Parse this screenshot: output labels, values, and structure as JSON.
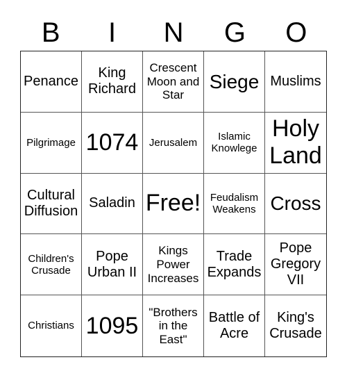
{
  "header": {
    "letters": [
      "B",
      "I",
      "N",
      "G",
      "O"
    ]
  },
  "cells": [
    [
      {
        "text": "Penance",
        "size": "s-md"
      },
      {
        "text": "King Richard",
        "size": "s-md"
      },
      {
        "text": "Crescent Moon and Star",
        "size": "s-sm"
      },
      {
        "text": "Siege",
        "size": "s-lg"
      },
      {
        "text": "Muslims",
        "size": "s-md"
      }
    ],
    [
      {
        "text": "Pilgrimage",
        "size": "s-xs"
      },
      {
        "text": "1074",
        "size": "s-xl"
      },
      {
        "text": "Jerusalem",
        "size": "s-xs"
      },
      {
        "text": "Islamic Knowlege",
        "size": "s-xs"
      },
      {
        "text": "Holy Land",
        "size": "s-xl"
      }
    ],
    [
      {
        "text": "Cultural Diffusion",
        "size": "s-md"
      },
      {
        "text": "Saladin",
        "size": "s-md"
      },
      {
        "text": "Free!",
        "size": "s-xl"
      },
      {
        "text": "Feudalism Weakens",
        "size": "s-xs"
      },
      {
        "text": "Cross",
        "size": "s-lg"
      }
    ],
    [
      {
        "text": "Children's Crusade",
        "size": "s-xs"
      },
      {
        "text": "Pope Urban II",
        "size": "s-md"
      },
      {
        "text": "Kings Power Increases",
        "size": "s-sm"
      },
      {
        "text": "Trade Expands",
        "size": "s-md"
      },
      {
        "text": "Pope Gregory VII",
        "size": "s-md"
      }
    ],
    [
      {
        "text": "Christians",
        "size": "s-xs"
      },
      {
        "text": "1095",
        "size": "s-xl"
      },
      {
        "text": "\"Brothers in the East\"",
        "size": "s-sm"
      },
      {
        "text": "Battle of Acre",
        "size": "s-md"
      },
      {
        "text": "King's Crusade",
        "size": "s-md"
      }
    ]
  ]
}
